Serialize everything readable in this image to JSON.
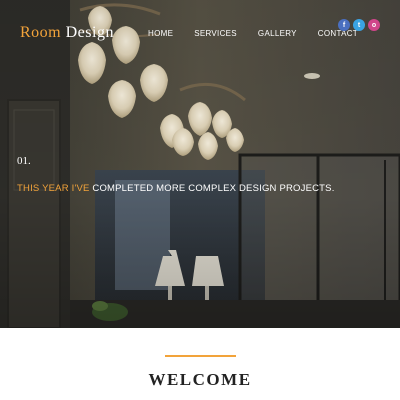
{
  "header": {
    "logo_first": "Room",
    "logo_second": "Design",
    "nav": [
      "HOME",
      "SERVICES",
      "GALLERY",
      "CONTACT"
    ],
    "social": [
      {
        "icon": "facebook-icon",
        "glyph": "f"
      },
      {
        "icon": "twitter-icon",
        "glyph": "t"
      },
      {
        "icon": "instagram-icon",
        "glyph": "o"
      }
    ]
  },
  "hero": {
    "slide_number": "01.",
    "caption_highlight": "THIS YEAR I'VE",
    "caption_rest": " COMPLETED MORE COMPLEX DESIGN PROJECTS."
  },
  "welcome": {
    "title": "WELCOME"
  },
  "colors": {
    "accent": "#f2a33a",
    "nav_text": "#ffffff",
    "welcome_text": "#222222"
  }
}
